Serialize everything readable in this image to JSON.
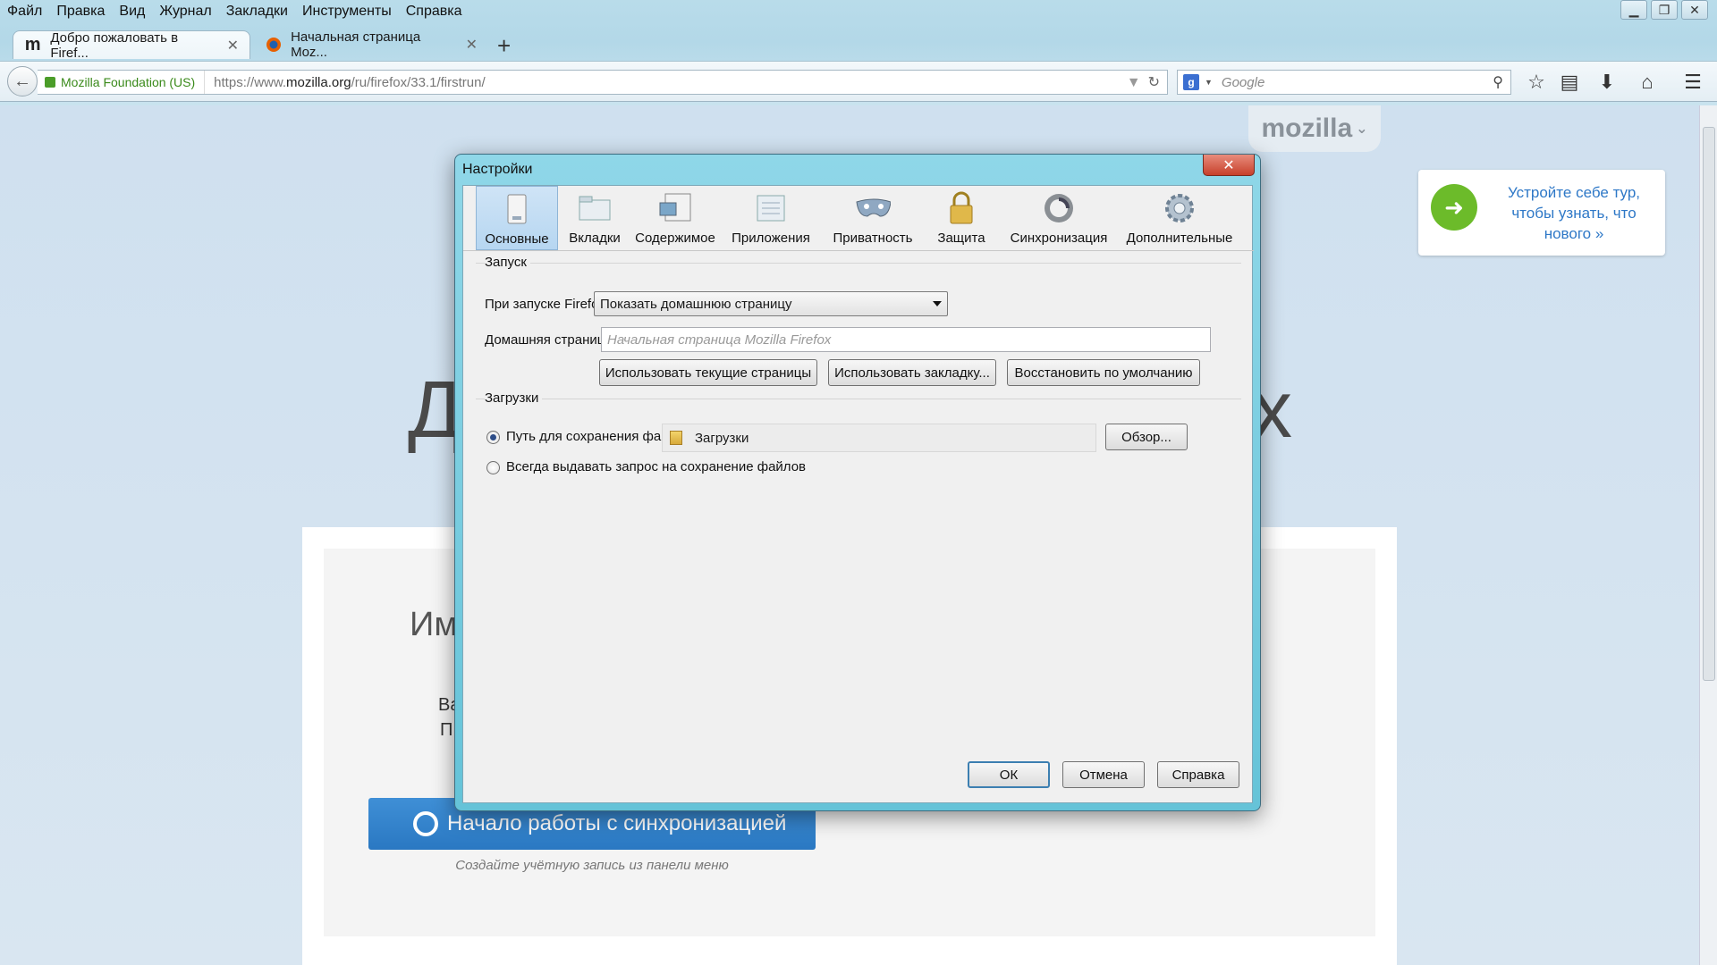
{
  "menubar": [
    "Файл",
    "Правка",
    "Вид",
    "Журнал",
    "Закладки",
    "Инструменты",
    "Справка"
  ],
  "tabs": [
    {
      "label": "Добро пожаловать в Firef...",
      "icon": "mozilla-m-icon",
      "active": true
    },
    {
      "label": "Начальная страница Moz...",
      "icon": "firefox-icon",
      "active": false
    }
  ],
  "navbar": {
    "identity": "Mozilla Foundation (US)",
    "url_prefix": "https://www.",
    "url_domain": "mozilla.org",
    "url_path": "/ru/firefox/33.1/firstrun/",
    "search_placeholder": "Google"
  },
  "page": {
    "logo": "mozilla",
    "tour_text": "Устройте себе тур, чтобы узнать, что нового »",
    "big_left": "Д",
    "big_right": "х",
    "card_name": "Им",
    "card_va": "Ва",
    "card_p": "П",
    "sync_button": "Начало работы с синхронизацией",
    "sync_hint": "Создайте учётную запись из панели меню"
  },
  "dialog": {
    "title": "Настройки",
    "close": "✕",
    "tabs": [
      {
        "label": "Основные",
        "icon": "general-icon",
        "selected": true
      },
      {
        "label": "Вкладки",
        "icon": "tabs-icon"
      },
      {
        "label": "Содержимое",
        "icon": "content-icon"
      },
      {
        "label": "Приложения",
        "icon": "applications-icon"
      },
      {
        "label": "Приватность",
        "icon": "privacy-mask-icon"
      },
      {
        "label": "Защита",
        "icon": "security-lock-icon"
      },
      {
        "label": "Синхронизация",
        "icon": "sync-icon"
      },
      {
        "label": "Дополнительные",
        "icon": "advanced-gear-icon"
      }
    ],
    "startup": {
      "group": "Запуск",
      "when_label": "При запуске Firefox:",
      "when_value": "Показать домашнюю страницу",
      "home_label": "Домашняя страница:",
      "home_placeholder": "Начальная страница Mozilla Firefox",
      "btn_current": "Использовать текущие страницы",
      "btn_bookmark": "Использовать закладку...",
      "btn_restore": "Восстановить по умолчанию"
    },
    "downloads": {
      "group": "Загрузки",
      "save_to_label": "Путь для сохранения файлов",
      "folder": "Загрузки",
      "browse": "Обзор...",
      "always_ask_label": "Всегда выдавать запрос на сохранение файлов",
      "save_to_selected": true
    },
    "footer": {
      "ok": "ОК",
      "cancel": "Отмена",
      "help": "Справка"
    }
  }
}
